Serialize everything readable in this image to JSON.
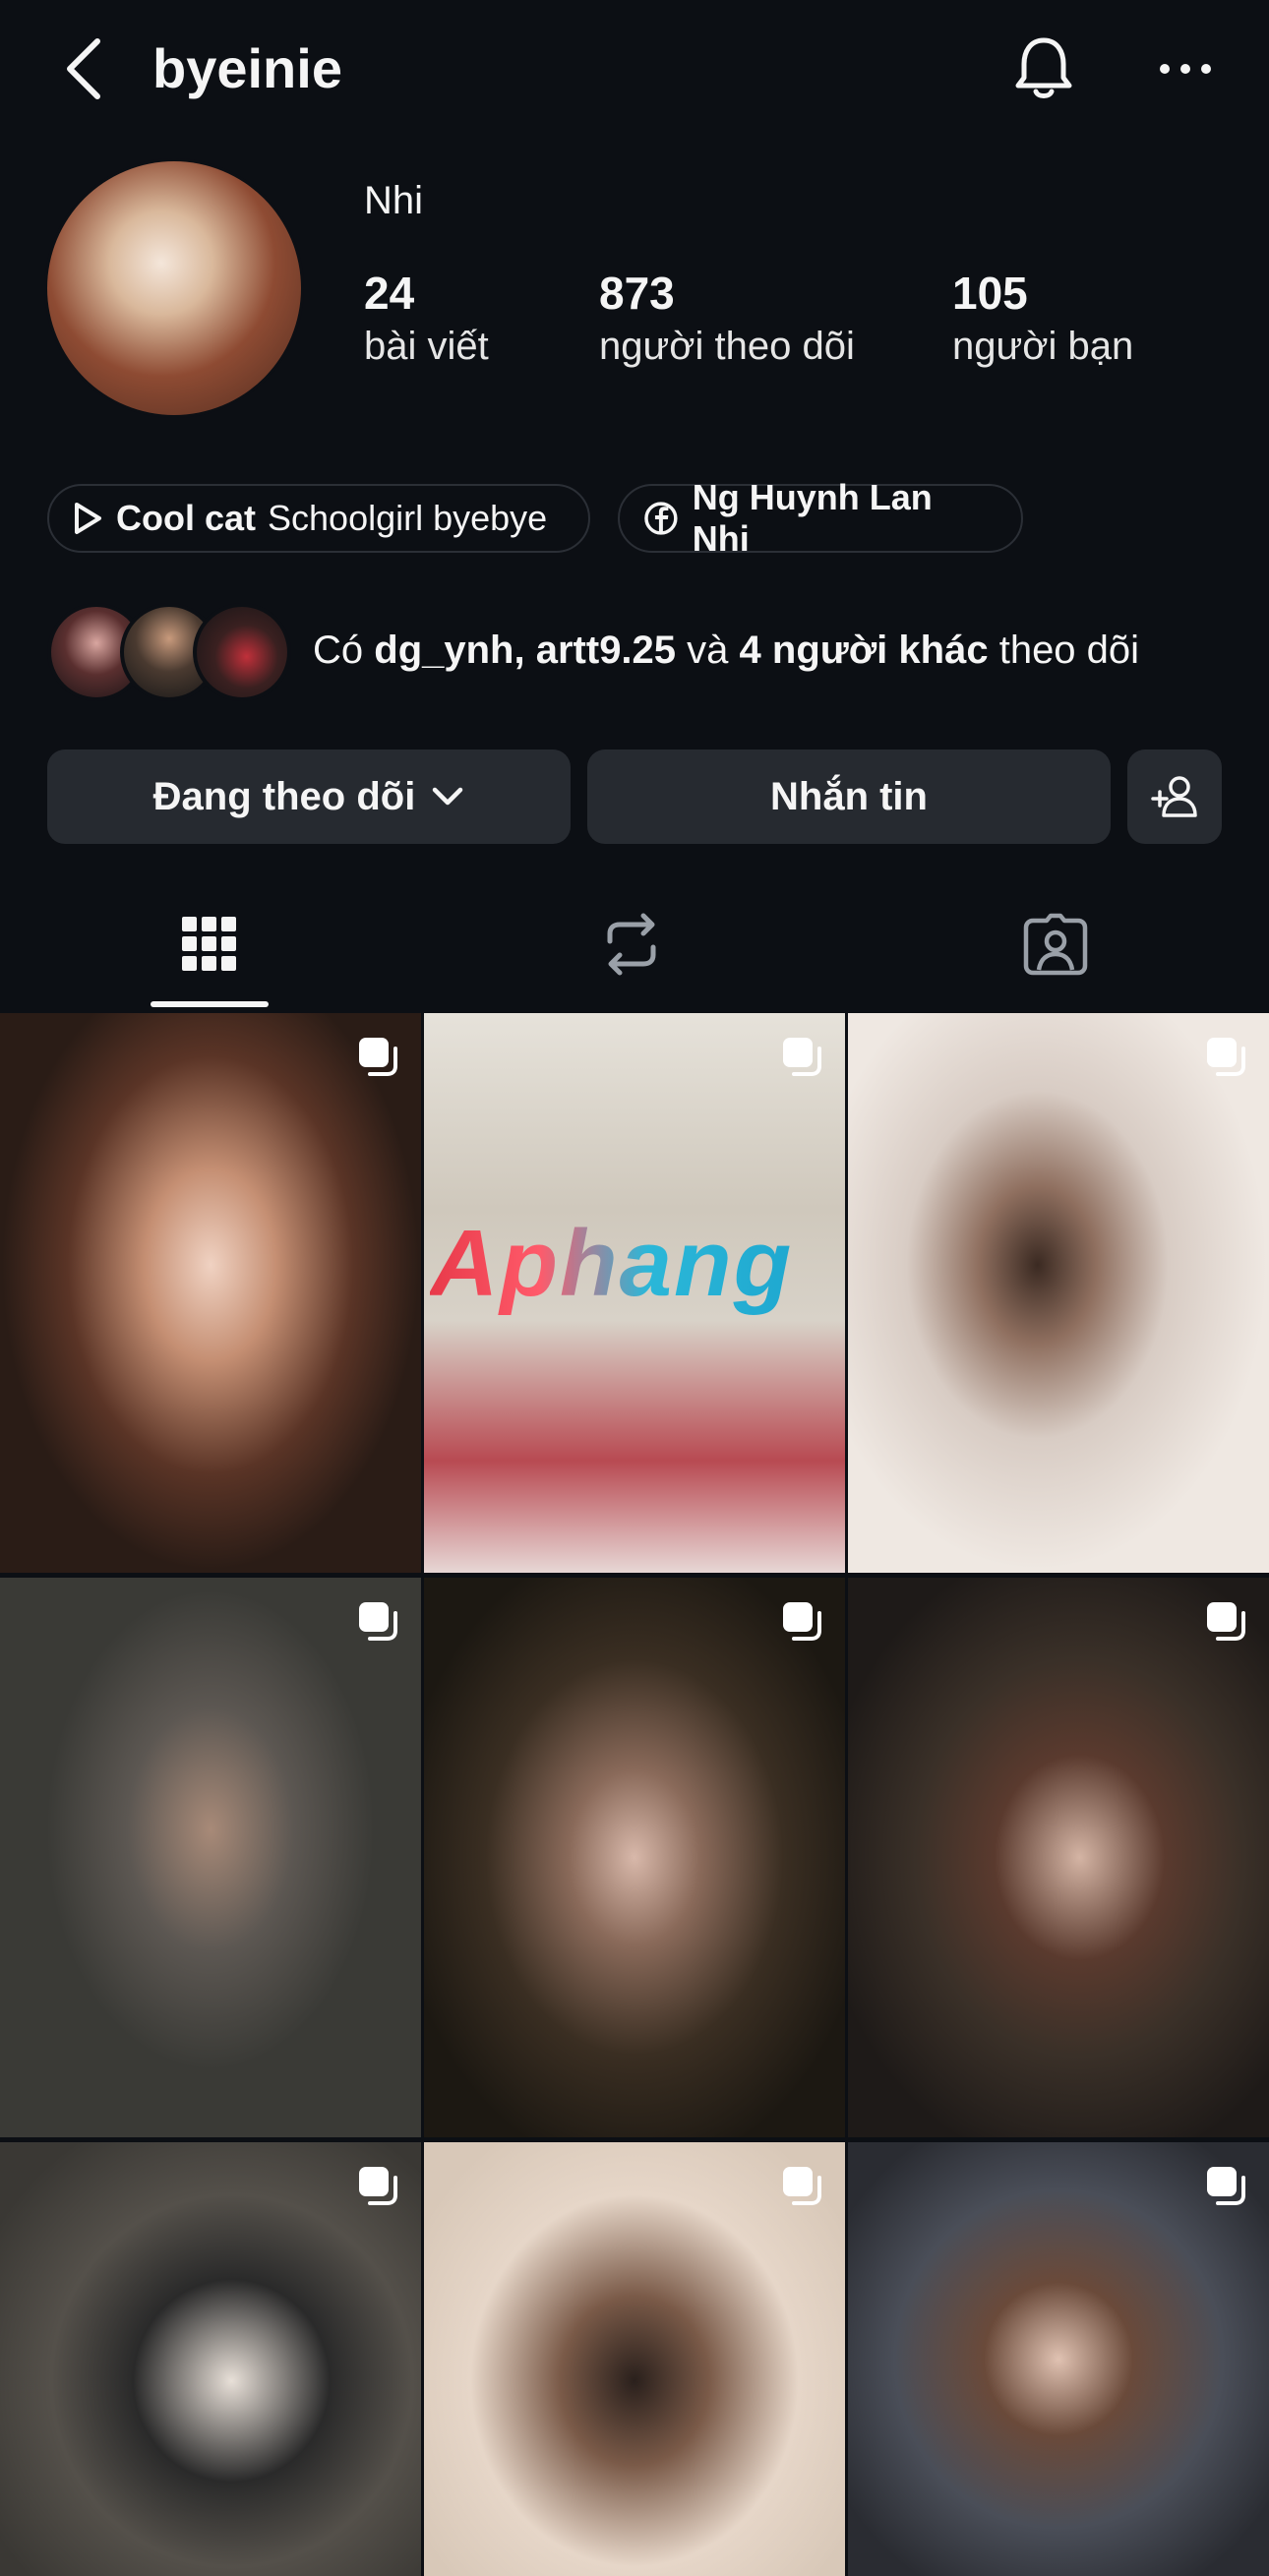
{
  "header": {
    "username": "byeinie",
    "back_icon": "chevron-left-icon",
    "bell_icon": "bell-icon",
    "more_icon": "more-horizontal-icon"
  },
  "profile": {
    "display_name": "Nhi",
    "stats": [
      {
        "value": "24",
        "label": "bài viết"
      },
      {
        "value": "873",
        "label": "người theo dõi"
      },
      {
        "value": "105",
        "label": "người bạn"
      }
    ]
  },
  "chips": {
    "music": {
      "icon": "play-icon",
      "title": "Cool cat",
      "subtitle": "Schoolgirl byebye"
    },
    "facebook": {
      "icon": "facebook-icon",
      "label": "Ng Huynh Lan Nhi"
    }
  },
  "followed_by": {
    "prefix": "Có",
    "user1": "dg_ynh,",
    "user2": "artt9.25",
    "and": "và",
    "others": "4 người khác",
    "suffix": "theo dõi"
  },
  "actions": {
    "following_label": "Đang theo dõi",
    "message_label": "Nhắn tin",
    "add_icon": "add-person-icon"
  },
  "tabs": [
    {
      "name": "grid",
      "icon": "grid-icon",
      "active": true
    },
    {
      "name": "reposts",
      "icon": "repost-icon",
      "active": false
    },
    {
      "name": "tagged",
      "icon": "tagged-person-icon",
      "active": false
    }
  ],
  "watermark_text": "Aphang",
  "colors": {
    "background": "#0c0f14",
    "button": "#262a30",
    "text": "#f5f5f5"
  }
}
